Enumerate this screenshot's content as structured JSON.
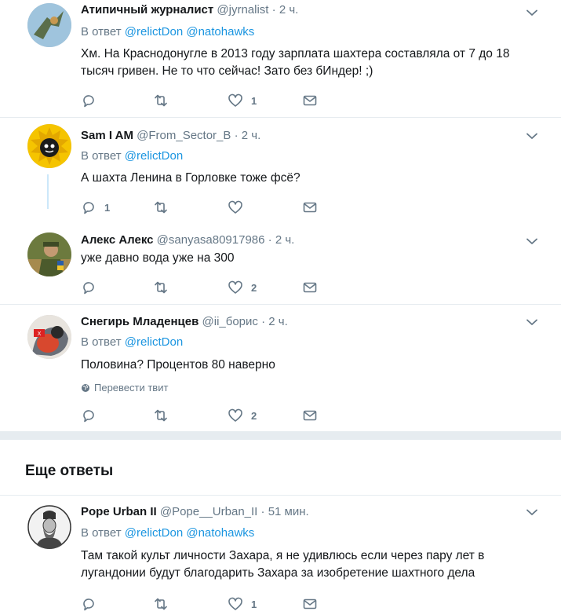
{
  "tweets": [
    {
      "name": "Атипичный журналист",
      "handle": "@jyrnalist",
      "time": "2 ч.",
      "reply_label": "В ответ",
      "mentions": [
        "@relictDon",
        "@natohawks"
      ],
      "text": "Хм. На Краснодонугле в 2013 году зарплата шахтера составляла от 7 до 18 тысяч гривен. Не то что сейчас! Зато без бИндер! ;)",
      "reply_count": "",
      "retweet_count": "",
      "like_count": "1"
    },
    {
      "name": "Sam I AM",
      "handle": "@From_Sector_B",
      "time": "2 ч.",
      "reply_label": "В ответ",
      "mentions": [
        "@relictDon"
      ],
      "text": "А шахта Ленина в Горловке тоже фсё?",
      "reply_count": "1",
      "retweet_count": "",
      "like_count": ""
    },
    {
      "name": "Алекс Алекс",
      "handle": "@sanyasa80917986",
      "time": "2 ч.",
      "text": "уже давно вода уже на 300",
      "reply_count": "",
      "retweet_count": "",
      "like_count": "2"
    },
    {
      "name": "Снегирь Младенцев",
      "handle": "@ii_борис",
      "time": "2 ч.",
      "reply_label": "В ответ",
      "mentions": [
        "@relictDon"
      ],
      "text": "Половина? Процентов 80 наверно",
      "translate": "Перевести твит",
      "reply_count": "",
      "retweet_count": "",
      "like_count": "2"
    },
    {
      "name": "Pope Urban II",
      "handle": "@Pope__Urban_II",
      "time": "51 мин.",
      "reply_label": "В ответ",
      "mentions": [
        "@relictDon",
        "@natohawks"
      ],
      "text": "Там такой культ личности Захара, я не удивлюсь если через пару лет в лугандонии будут благодарить Захара за изобретение шахтного дела",
      "reply_count": "",
      "retweet_count": "",
      "like_count": "1"
    }
  ],
  "section_title": "Еще ответы",
  "separator": "·",
  "colors": {
    "link": "#1b95e0",
    "muted": "#657786",
    "text": "#14171a",
    "divider": "#e6ecf0",
    "thread": "#cce7fa"
  },
  "icons": [
    "reply-icon",
    "retweet-icon",
    "like-icon",
    "dm-icon",
    "caret-down-icon",
    "globe-icon"
  ]
}
